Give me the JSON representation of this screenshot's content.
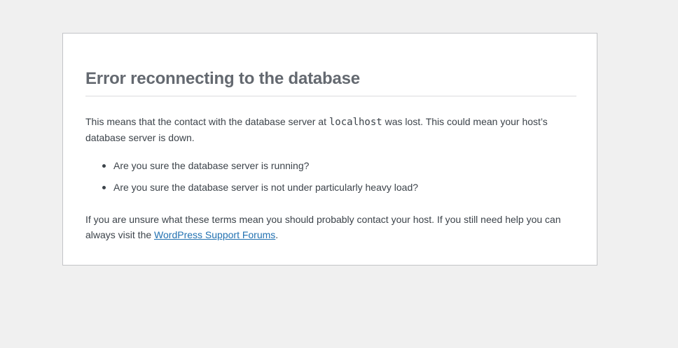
{
  "error": {
    "title": "Error reconnecting to the database",
    "paragraph1_before": "This means that the contact with the database server at ",
    "host": "localhost",
    "paragraph1_after": " was lost. This could mean your host’s database server is down.",
    "checklist": [
      "Are you sure the database server is running?",
      "Are you sure the database server is not under particularly heavy load?"
    ],
    "paragraph2_before": "If you are unsure what these terms mean you should probably contact your host. If you still need help you can always visit the ",
    "support_link_label": "WordPress Support Forums",
    "paragraph2_after": "."
  },
  "colors": {
    "background": "#f0f0f0",
    "card": "#ffffff",
    "title": "#646970",
    "text": "#3c434a",
    "link": "#2271b1"
  }
}
